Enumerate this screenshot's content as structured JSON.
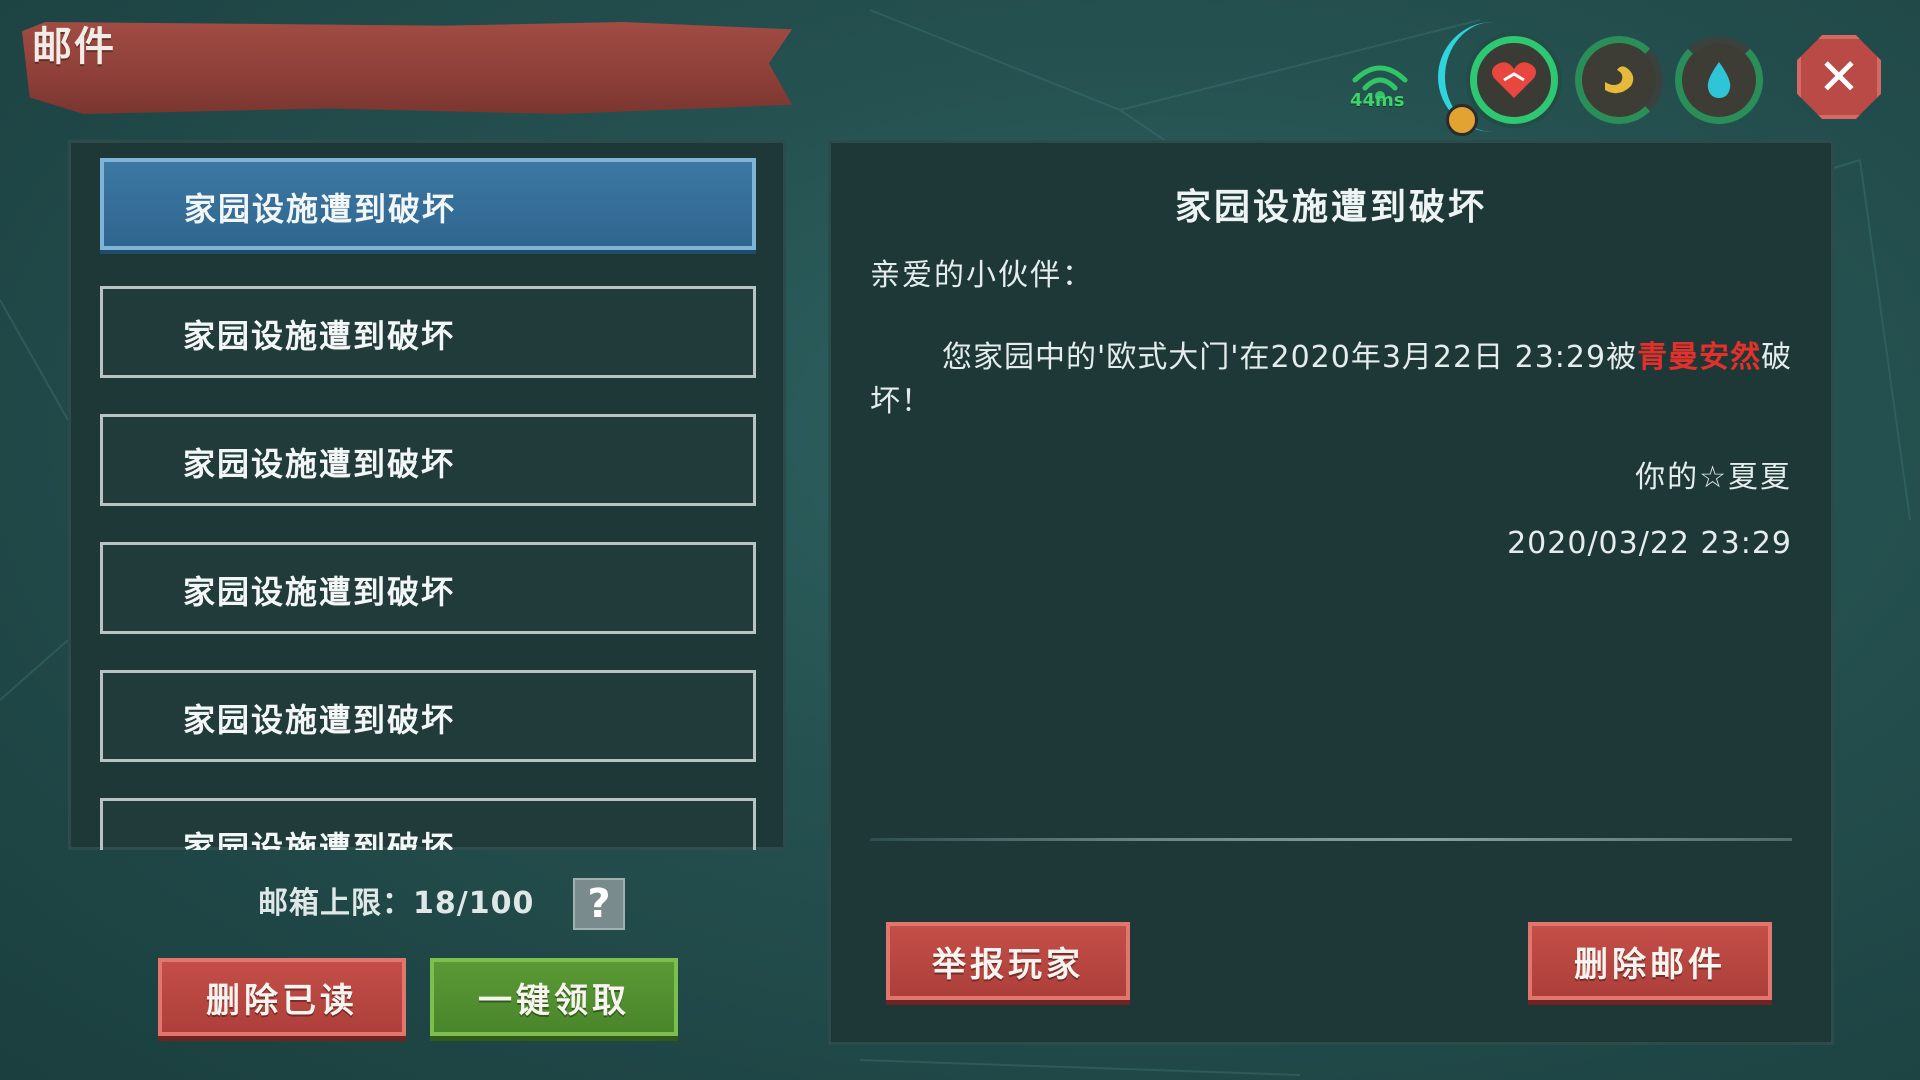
{
  "header": {
    "title": "邮件",
    "ping": "44ms",
    "status_icons": [
      "health-icon",
      "hunger-icon",
      "water-icon"
    ],
    "close_icon": "✕"
  },
  "mail_list": {
    "items": [
      {
        "subject": "家园设施遭到破坏",
        "selected": true
      },
      {
        "subject": "家园设施遭到破坏",
        "selected": false
      },
      {
        "subject": "家园设施遭到破坏",
        "selected": false
      },
      {
        "subject": "家园设施遭到破坏",
        "selected": false
      },
      {
        "subject": "家园设施遭到破坏",
        "selected": false
      },
      {
        "subject": "家园设施遭到破坏",
        "selected": false
      }
    ],
    "capacity_label": "邮箱上限：",
    "capacity_value": "18/100",
    "help_label": "?",
    "delete_read_label": "删除已读",
    "claim_all_label": "一键领取"
  },
  "detail": {
    "title": "家园设施遭到破坏",
    "greeting": "亲爱的小伙伴：",
    "body_prefix": "您家园中的'欧式大门'在2020年3月22日 23:29被",
    "body_highlight": "青曼安然",
    "body_suffix": "破坏！",
    "signature": "你的☆夏夏",
    "date": "2020/03/22 23:29",
    "report_label": "举报玩家",
    "delete_label": "删除邮件"
  },
  "colors": {
    "background": "#24504f",
    "title_banner": "#8d3f38",
    "selected_item": "#2f668f",
    "red_button": "#ad3f3a",
    "green_button": "#4a852b",
    "highlight_text": "#e3302a",
    "ping_green": "#3dd56b"
  }
}
